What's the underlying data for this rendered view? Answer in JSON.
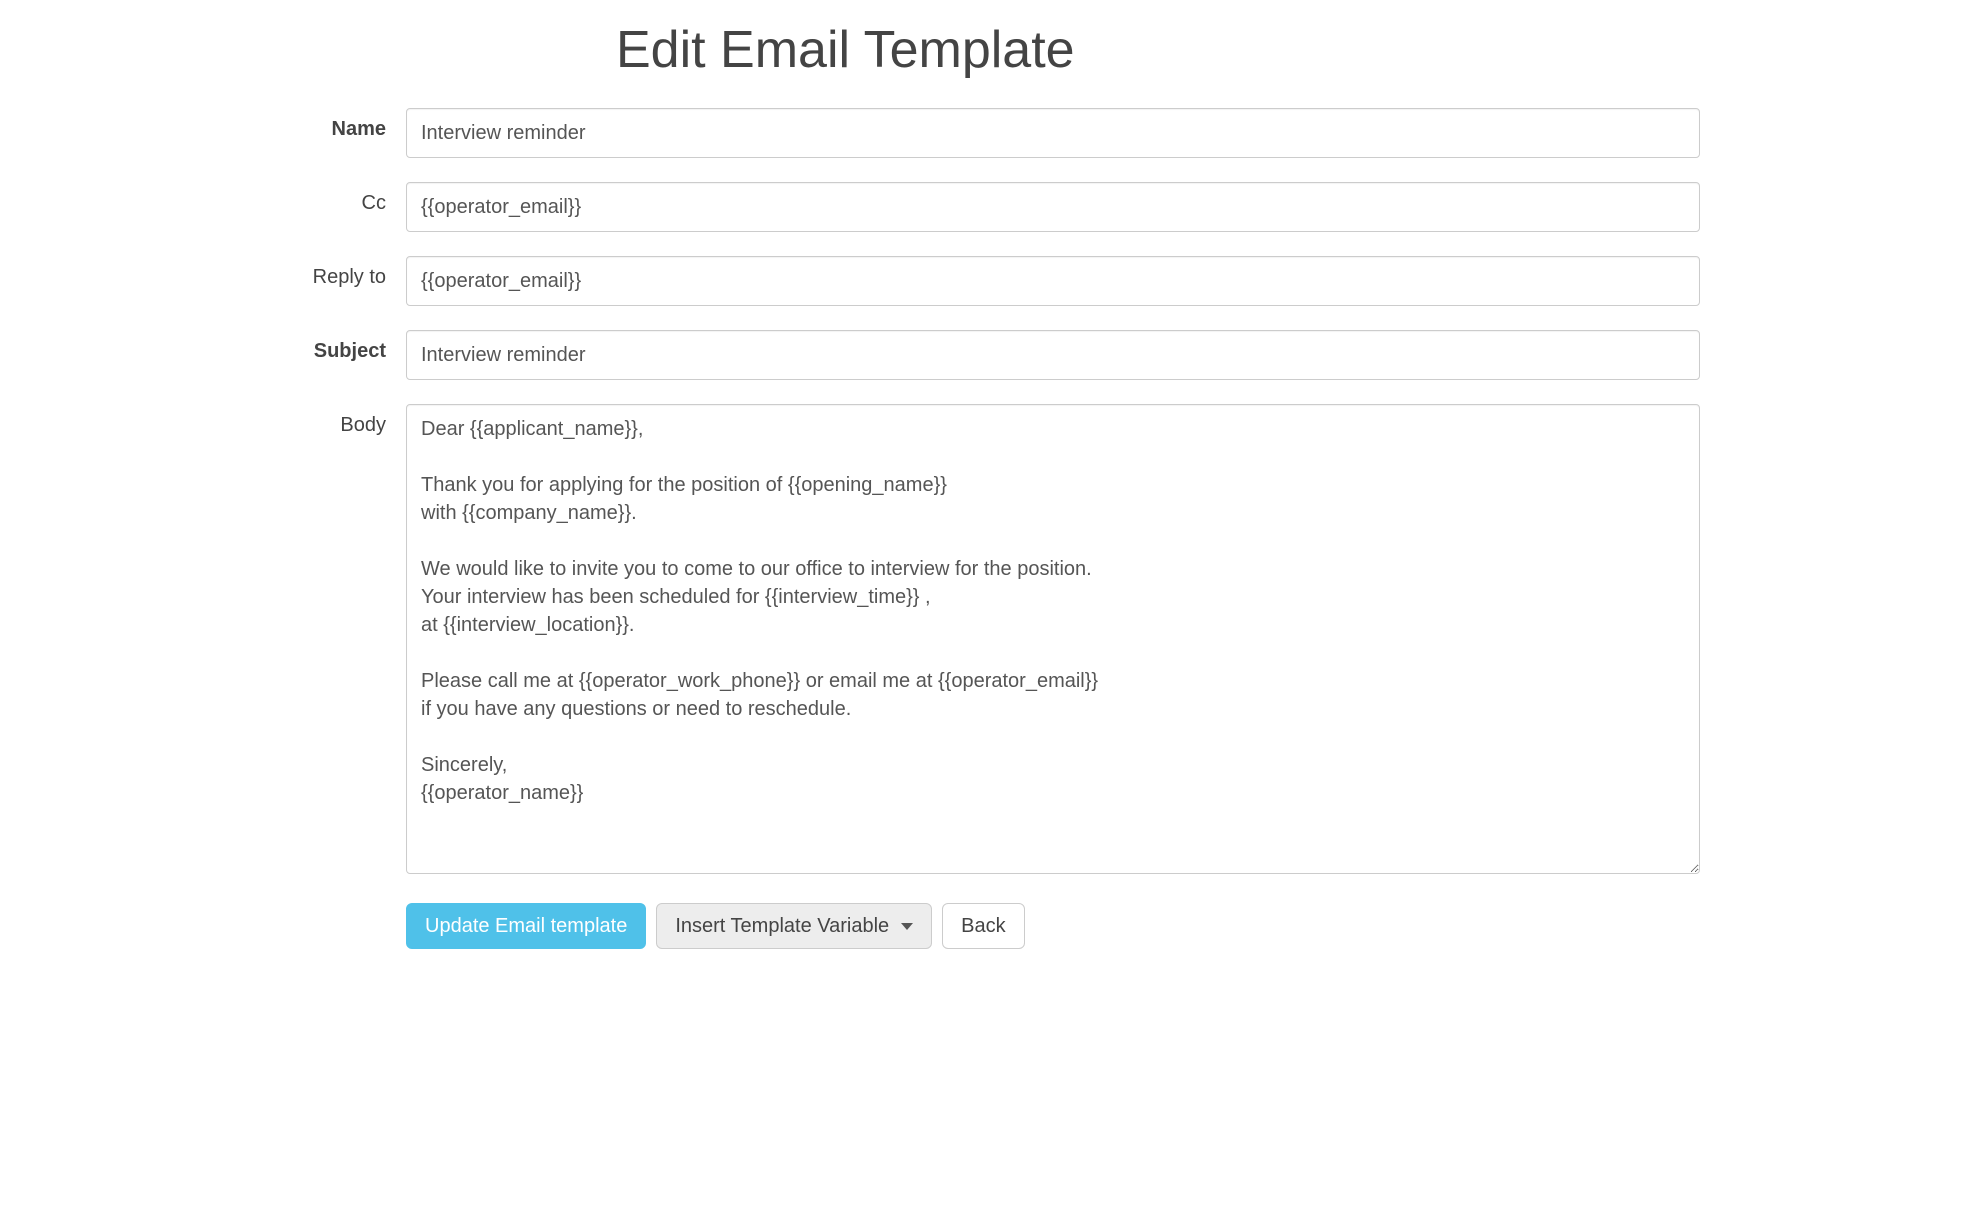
{
  "page": {
    "title": "Edit Email Template"
  },
  "labels": {
    "name": "Name",
    "cc": "Cc",
    "reply_to": "Reply to",
    "subject": "Subject",
    "body": "Body"
  },
  "fields": {
    "name": "Interview reminder",
    "cc": "{{operator_email}}",
    "reply_to": "{{operator_email}}",
    "subject": "Interview reminder",
    "body": "Dear {{applicant_name}},\n\nThank you for applying for the position of {{opening_name}}\nwith {{company_name}}.\n\nWe would like to invite you to come to our office to interview for the position.\nYour interview has been scheduled for {{interview_time}} ,\nat {{interview_location}}.\n\nPlease call me at {{operator_work_phone}} or email me at {{operator_email}}\nif you have any questions or need to reschedule.\n\nSincerely,\n{{operator_name}}"
  },
  "buttons": {
    "update": "Update Email template",
    "insert_variable": "Insert Template Variable",
    "back": "Back"
  }
}
